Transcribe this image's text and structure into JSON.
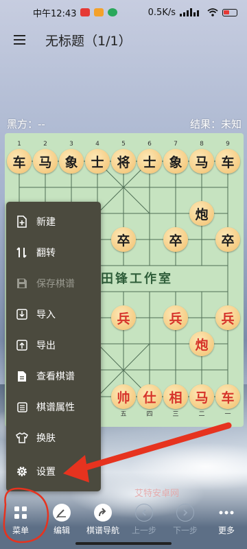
{
  "status_bar": {
    "time": "中午12:43",
    "network_speed": "0.5K/s",
    "battery_color": "#e53935"
  },
  "app_bar": {
    "menu_icon": "hamburger-icon",
    "title": "无标题（1/1）"
  },
  "game_info": {
    "black_player": "黑方：--",
    "result": "结果：未知"
  },
  "board": {
    "top_coords": [
      "1",
      "2",
      "3",
      "4",
      "5",
      "6",
      "7",
      "8",
      "9"
    ],
    "bottom_coords": [
      "五",
      "四",
      "三",
      "二",
      "一"
    ],
    "river_text": "田锋工作室",
    "black_back_row": [
      "车",
      "马",
      "象",
      "士",
      "将",
      "士",
      "象",
      "马",
      "车"
    ],
    "black_cannon": "炮",
    "black_soldiers": [
      "卒",
      "卒",
      "卒"
    ],
    "red_soldiers": [
      "兵",
      "兵",
      "兵"
    ],
    "red_cannon": "炮",
    "red_back_row": [
      "帅",
      "仕",
      "相",
      "马",
      "车"
    ],
    "colors": {
      "board": "#c6e3c0",
      "red": "#d6332a",
      "black": "#1e1e1e",
      "piece": "#f5cc84"
    }
  },
  "popup_menu": {
    "items": [
      {
        "label": "新建",
        "icon": "new-file-icon",
        "enabled": true
      },
      {
        "label": "翻转",
        "icon": "flip-icon",
        "enabled": true
      },
      {
        "label": "保存棋谱",
        "icon": "save-icon",
        "enabled": false
      },
      {
        "label": "导入",
        "icon": "import-icon",
        "enabled": true
      },
      {
        "label": "导出",
        "icon": "export-icon",
        "enabled": true
      },
      {
        "label": "查看棋谱",
        "icon": "view-record-icon",
        "enabled": true
      },
      {
        "label": "棋谱属性",
        "icon": "properties-icon",
        "enabled": true
      },
      {
        "label": "换肤",
        "icon": "shirt-icon",
        "enabled": true
      },
      {
        "label": "设置",
        "icon": "gear-icon",
        "enabled": true
      }
    ]
  },
  "bottom_nav": {
    "items": [
      {
        "label": "菜单",
        "icon": "grid-icon",
        "enabled": true
      },
      {
        "label": "编辑",
        "icon": "edit-icon",
        "enabled": true
      },
      {
        "label": "棋谱导航",
        "icon": "navigate-icon",
        "enabled": true
      },
      {
        "label": "上一步",
        "icon": "prev-icon",
        "enabled": false
      },
      {
        "label": "下一步",
        "icon": "next-icon",
        "enabled": false
      },
      {
        "label": "更多",
        "icon": "more-icon",
        "enabled": true
      }
    ]
  },
  "watermark": "艾特安卓网",
  "annotation_color": "#e6331f"
}
